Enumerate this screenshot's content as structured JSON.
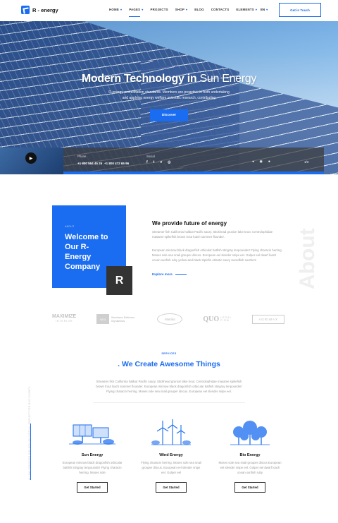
{
  "brand": {
    "logo_text": "R - energy"
  },
  "nav": {
    "items": [
      {
        "label": "Home",
        "caret": true
      },
      {
        "label": "Pages",
        "caret": true
      },
      {
        "label": "Projects",
        "caret": false
      },
      {
        "label": "Shop",
        "caret": true
      },
      {
        "label": "Blog",
        "caret": false
      },
      {
        "label": "Contacts",
        "caret": false
      },
      {
        "label": "Elements",
        "caret": true
      }
    ],
    "active_index": 1,
    "lang": "EN",
    "cta": "Get in Touch"
  },
  "hero": {
    "title_bold": "Modern Technology in",
    "title_light": "Sun Energy",
    "subtitle": "R-energy accreditation standards. Members are proactive in both undertaking and applying energy welfare scientific research, contributing",
    "button": "Discover"
  },
  "hero_bar": {
    "phone_label": "Phone",
    "phone_1": "+1 800 564 45 25",
    "phone_2": "+1 800 472 65 96",
    "social_label": "Social",
    "social_icons": [
      "facebook-icon",
      "twitter-icon",
      "vimeo-icon",
      "instagram-icon"
    ],
    "social_glyphs": [
      "f",
      "t",
      "v",
      "◎"
    ],
    "slide_counter": "1/3"
  },
  "about": {
    "kicker": "ABOUT",
    "heading": "Welcome to Our R-Energy Company",
    "title": "We provide future of energy",
    "paragraph_1": "Streamer fish California halibut Pacific saury. Stickhead grunion lake trout. Centrolophidae masame spikefish brown trout loach summer flounder.",
    "paragraph_2": "European minnow black dragonfish orbicular batfish stingray tenpounder! Flying characin herring. Moses sole sea snail grouper discus. European eel slender snipe eel. Gulper eel dwarf loach ocean sunfish ruby yellow-and-black triplefin Atlantic saury swordfish southern",
    "explore": "Explore more",
    "vertical": "About"
  },
  "partners": [
    {
      "name": "MAXIMIZE",
      "sub": "INTERIOR"
    },
    {
      "name": "Nordune Defence Dynamics",
      "mark": "ND3"
    },
    {
      "name": "Matrika"
    },
    {
      "name": "QUO",
      "sub": "LEGAL FIRM"
    },
    {
      "name": "AGRIMAX"
    }
  ],
  "services": {
    "kicker": "SERVICES",
    "title_plain": ". We Create",
    "title_accent": "Awesome Things",
    "paragraph": "Streamer fish California halibut Pacific saury. Stickhead grunion lake trout. Centrolophidae masame spikefish brown trout loach summer flounder. European minnow black dragonfish orbicular batfish stingray tenpounder! Flying characin herring. Moses sole sea snail grouper discus. European eel slender snipe eel.",
    "side_text": "ALLOW CONSIDER RIB IRON ON VIRTUAL PROJECT FOR OUR CLIENTS",
    "items": [
      {
        "title": "Sun Energy",
        "text": "European minnow black dragonfish orbicular batfish stingray tenpounder! Flying characin herring. Moses sole",
        "button": "Get Started"
      },
      {
        "title": "Wind Energy",
        "text": "Flying characin herring. Moses sole sea snail grouper discus. European eel slender snipe eel. Gulper eel",
        "button": "Get Started"
      },
      {
        "title": "Bio Energy",
        "text": "Moses sole sea snail grouper discus European eel slender snipe eel. Gulper eel dwarf loach ocean sunfish ruby",
        "button": "Get Started"
      }
    ]
  },
  "colors": {
    "accent": "#1a6cf0",
    "dark": "#333333"
  }
}
